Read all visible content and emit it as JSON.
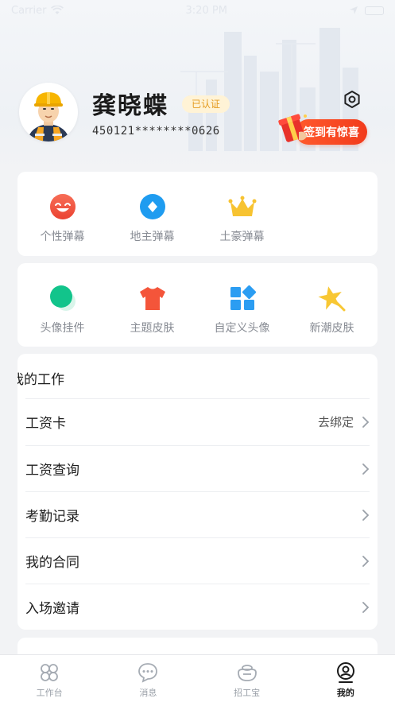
{
  "status_bar": {
    "carrier": "Carrier",
    "time": "3:20 PM"
  },
  "profile": {
    "name": "龚晓蝶",
    "verified_label": "已认证",
    "id_number": "450121********0626",
    "checkin_label": "签到有惊喜"
  },
  "danmaku_card": {
    "items": [
      {
        "label": "个性弹幕",
        "icon": "smile-face-icon",
        "color": "#f2503f"
      },
      {
        "label": "地主弹幕",
        "icon": "blue-diamond-icon",
        "color": "#1f9cf0"
      },
      {
        "label": "土豪弹幕",
        "icon": "crown-icon",
        "color": "#f7c331"
      }
    ]
  },
  "decor_card": {
    "items": [
      {
        "label": "头像挂件",
        "icon": "green-orb-icon",
        "color": "#12c48b"
      },
      {
        "label": "主题皮肤",
        "icon": "tshirt-icon",
        "color": "#f4553a"
      },
      {
        "label": "自定义头像",
        "icon": "grid-tiles-icon",
        "color": "#2b9df2"
      },
      {
        "label": "新潮皮肤",
        "icon": "star-icon",
        "color": "#f8c733"
      }
    ]
  },
  "work_section": {
    "title": "我的工作",
    "items": [
      {
        "label": "工资卡",
        "value": "去绑定"
      },
      {
        "label": "工资查询",
        "value": ""
      },
      {
        "label": "考勤记录",
        "value": ""
      },
      {
        "label": "我的合同",
        "value": ""
      },
      {
        "label": "入场邀请",
        "value": ""
      }
    ]
  },
  "bottom_nav": {
    "items": [
      {
        "label": "工作台",
        "icon": "workbench-icon"
      },
      {
        "label": "消息",
        "icon": "message-icon"
      },
      {
        "label": "招工宝",
        "icon": "recruit-icon"
      },
      {
        "label": "我的",
        "icon": "profile-icon"
      }
    ],
    "active": "我的"
  },
  "colors": {
    "accent": "#f23b1c",
    "badge_text": "#e49a1e",
    "badge_bg": "#fff3d6"
  }
}
